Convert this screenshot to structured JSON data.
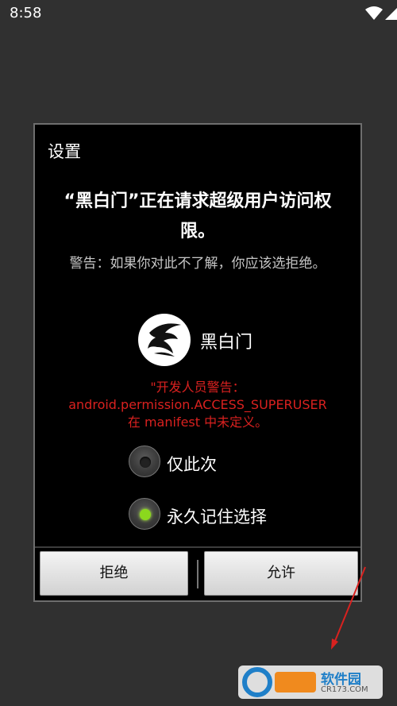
{
  "status_bar": {
    "time": "8:58"
  },
  "dialog": {
    "title": "设置",
    "heading": "“黑白门”正在请求超级用户访问权限。",
    "warning": "警告：如果你对此不了解，你应该选拒绝。",
    "app_name": "黑白门",
    "dev_warning_line1": "\"开发人员警告：",
    "dev_warning_line2": "android.permission.ACCESS_SUPERUSER",
    "dev_warning_line3": "在 manifest 中未定义。",
    "options": [
      {
        "label": "仅此次",
        "selected": false
      },
      {
        "label": "永久记住选择",
        "selected": true
      }
    ],
    "buttons": {
      "reject": "拒绝",
      "allow": "允许"
    }
  },
  "watermark": {
    "brand": "软件园",
    "url": "CR173.COM"
  },
  "colors": {
    "accent_warning": "#d9211f",
    "radio_on": "#8bd81d"
  }
}
